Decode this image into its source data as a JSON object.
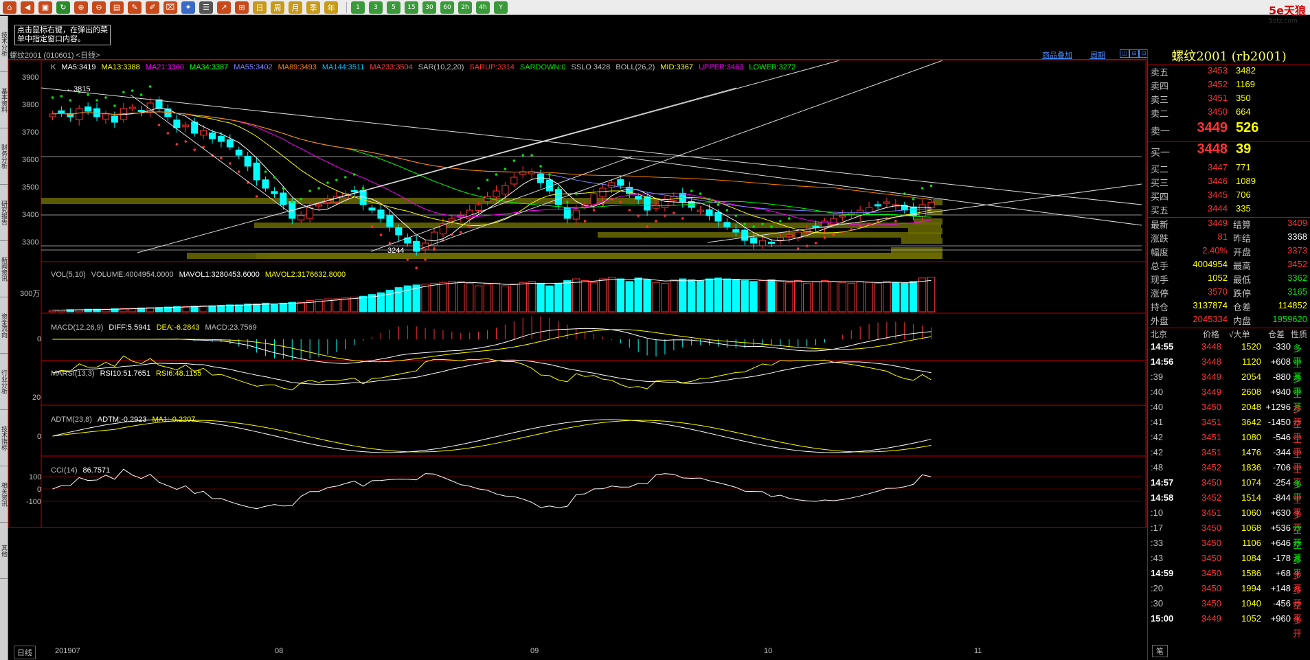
{
  "toolbar": {
    "buttons": [
      {
        "name": "home-icon",
        "glyph": "⌂",
        "color": "#c84a1a"
      },
      {
        "name": "back-icon",
        "glyph": "◀",
        "color": "#c84a1a"
      },
      {
        "name": "book-icon",
        "glyph": "▣",
        "color": "#c84a1a"
      },
      {
        "name": "refresh-icon",
        "glyph": "↻",
        "color": "#2a8a2a"
      },
      {
        "name": "zoom-in-icon",
        "glyph": "⊕",
        "color": "#c84a1a"
      },
      {
        "name": "zoom-out-icon",
        "glyph": "⊖",
        "color": "#c84a1a"
      },
      {
        "name": "bar-chart-icon",
        "glyph": "▤",
        "color": "#c84a1a"
      },
      {
        "name": "pen-icon",
        "glyph": "✎",
        "color": "#c84a1a"
      },
      {
        "name": "paint-icon",
        "glyph": "✐",
        "color": "#c84a1a"
      },
      {
        "name": "filter-icon",
        "glyph": "⌧",
        "color": "#c84a1a"
      },
      {
        "name": "new-icon",
        "glyph": "✦",
        "color": "#3a6ac8"
      },
      {
        "name": "list-icon",
        "glyph": "☰",
        "color": "#555555"
      },
      {
        "name": "trend-icon",
        "glyph": "↗",
        "color": "#c84a1a"
      },
      {
        "name": "tick-icon",
        "glyph": "⊞",
        "color": "#c84a1a"
      },
      {
        "name": "day-icon",
        "glyph": "日",
        "color": "#c89a1a"
      },
      {
        "name": "week-icon",
        "glyph": "周",
        "color": "#c89a1a"
      },
      {
        "name": "month-icon",
        "glyph": "月",
        "color": "#c89a1a"
      },
      {
        "name": "quarter-icon",
        "glyph": "季",
        "color": "#c89a1a"
      },
      {
        "name": "year-icon",
        "glyph": "年",
        "color": "#c89a1a"
      }
    ],
    "periods": [
      "1",
      "3",
      "5",
      "15",
      "30",
      "60",
      "2h",
      "4h",
      "Y"
    ],
    "brand": "5e天狼",
    "brand_url": "5etz.com"
  },
  "left_tabs": [
    "技术分析",
    "基本资料",
    "财务分析",
    "研究报告",
    "新闻资讯",
    "资金流向",
    "行业分析",
    "技术指标",
    "相关资讯",
    "其他"
  ],
  "hint": "点击鼠标右键，在弹出的菜单中指定窗口内容。",
  "chart_header": {
    "title": "螺纹2001 (010601) <日线>",
    "overlay_link": "商品叠加",
    "period_link": "周期",
    "buttons": [
      "◫",
      "⊟",
      "⊡"
    ]
  },
  "main_indicators": [
    {
      "text": "K",
      "color": "#c0c0c0"
    },
    {
      "text": "MA5:3419",
      "color": "#ffffff"
    },
    {
      "text": "MA13:3388",
      "color": "#ffff00"
    },
    {
      "text": "MA21:3360",
      "color": "#ff00ff"
    },
    {
      "text": "MA34:3387",
      "color": "#00ff00"
    },
    {
      "text": "MA55:3402",
      "color": "#8080ff"
    },
    {
      "text": "MA89:3493",
      "color": "#ff8000"
    },
    {
      "text": "MA144:3511",
      "color": "#00c0ff"
    },
    {
      "text": "MA233:3504",
      "color": "#ff4040"
    },
    {
      "text": "SAR(10,2,20)",
      "color": "#c0c0c0"
    },
    {
      "text": "SARUP:3314",
      "color": "#ff3232"
    },
    {
      "text": "SARDOWN:0",
      "color": "#00e600"
    },
    {
      "text": "SSLO 3428",
      "color": "#c0c0c0"
    },
    {
      "text": "BOLL(26,2)",
      "color": "#c0c0c0"
    },
    {
      "text": "MID:3367",
      "color": "#ffff00"
    },
    {
      "text": "UPPER:3463",
      "color": "#ff00ff"
    },
    {
      "text": "LOWER:3272",
      "color": "#00ff00"
    }
  ],
  "price_axis": [
    "3900",
    "3800",
    "3700",
    "3600",
    "3500",
    "3400",
    "3300"
  ],
  "annotations": {
    "high": "←3815",
    "low": "3244"
  },
  "vol_indicators": [
    {
      "text": "VOL(5,10)",
      "color": "#c0c0c0"
    },
    {
      "text": "VOLUME:4004954.0000",
      "color": "#c0c0c0"
    },
    {
      "text": "MAVOL1:3280453.6000",
      "color": "#ffffff"
    },
    {
      "text": "MAVOL2:3176632.8000",
      "color": "#ffff00"
    }
  ],
  "vol_axis": "300万",
  "macd_indicators": [
    {
      "text": "MACD(12,26,9)",
      "color": "#c0c0c0"
    },
    {
      "text": "DIFF:5.5941",
      "color": "#ffffff"
    },
    {
      "text": "DEA:-6.2843",
      "color": "#ffff00"
    },
    {
      "text": "MACD:23.7569",
      "color": "#c0c0c0"
    }
  ],
  "macd_axis": "0",
  "marsi_indicators": [
    {
      "text": "MARSI(13,3)",
      "color": "#c0c0c0"
    },
    {
      "text": "RSI10:51.7651",
      "color": "#ffffff"
    },
    {
      "text": "RSI6:48.1155",
      "color": "#ffff00"
    }
  ],
  "marsi_axis": "20",
  "adtm_indicators": [
    {
      "text": "ADTM(23,8)",
      "color": "#c0c0c0"
    },
    {
      "text": "ADTM:-0.2923",
      "color": "#ffffff"
    },
    {
      "text": "MA1:-0.2207",
      "color": "#ffff00"
    }
  ],
  "adtm_axis": "0",
  "cci_indicators": [
    {
      "text": "CCI(14)",
      "color": "#c0c0c0"
    },
    {
      "text": "86.7571",
      "color": "#ffffff"
    }
  ],
  "cci_axis": [
    "100",
    "0",
    "-100"
  ],
  "bottom": {
    "day_tab": "日线",
    "x_labels": [
      "201907",
      "08",
      "09",
      "10",
      "11"
    ],
    "pen_tab": "笔"
  },
  "quote": {
    "title": "螺纹2001 (rb2001)",
    "asks": [
      {
        "label": "卖五",
        "price": "3453",
        "vol": "3482"
      },
      {
        "label": "卖四",
        "price": "3452",
        "vol": "1169"
      },
      {
        "label": "卖三",
        "price": "3451",
        "vol": "350"
      },
      {
        "label": "卖二",
        "price": "3450",
        "vol": "664"
      }
    ],
    "ask1": {
      "label": "卖一",
      "price": "3449",
      "vol": "526"
    },
    "bid1": {
      "label": "买一",
      "price": "3448",
      "vol": "39"
    },
    "bids": [
      {
        "label": "买二",
        "price": "3447",
        "vol": "771"
      },
      {
        "label": "买三",
        "price": "3446",
        "vol": "1089"
      },
      {
        "label": "买四",
        "price": "3445",
        "vol": "706"
      },
      {
        "label": "买五",
        "price": "3444",
        "vol": "335"
      }
    ],
    "stats": [
      {
        "l1": "最新",
        "v1": "3449",
        "c1": "red",
        "l2": "结算",
        "v2": "3409",
        "c2": "red"
      },
      {
        "l1": "涨跌",
        "v1": "81",
        "c1": "red",
        "l2": "昨结",
        "v2": "3368",
        "c2": "wht"
      },
      {
        "l1": "幅度",
        "v1": "2.40%",
        "c1": "red",
        "l2": "开盘",
        "v2": "3373",
        "c2": "red"
      },
      {
        "l1": "总手",
        "v1": "4004954",
        "c1": "yel",
        "l2": "最高",
        "v2": "3452",
        "c2": "red"
      },
      {
        "l1": "现手",
        "v1": "1052",
        "c1": "yel",
        "l2": "最低",
        "v2": "3362",
        "c2": "grn"
      },
      {
        "l1": "涨停",
        "v1": "3570",
        "c1": "red",
        "l2": "跌停",
        "v2": "3165",
        "c2": "grn"
      },
      {
        "l1": "持仓",
        "v1": "3137874",
        "c1": "yel",
        "l2": "仓差",
        "v2": "114852",
        "c2": "yel"
      },
      {
        "l1": "外盘",
        "v1": "2045334",
        "c1": "red",
        "l2": "内盘",
        "v2": "1959620",
        "c2": "grn"
      }
    ],
    "tick_header": {
      "time": "北京",
      "price": "价格",
      "vol": "√大单",
      "diff": "仓差",
      "nature": "性质"
    },
    "ticks": [
      {
        "t": "14:55",
        "big": true,
        "p": "3448",
        "pc": "red",
        "v": "1520",
        "d": "-330",
        "dc": "wht",
        "n": "多平",
        "nc": "grn"
      },
      {
        "t": "14:56",
        "big": true,
        "p": "3448",
        "pc": "red",
        "v": "1120",
        "d": "+608",
        "dc": "wht",
        "n": "空开",
        "nc": "grn"
      },
      {
        "t": ":39",
        "big": false,
        "p": "3449",
        "pc": "red",
        "v": "2054",
        "d": "-880",
        "dc": "wht",
        "n": "多平",
        "nc": "grn"
      },
      {
        "t": ":40",
        "big": false,
        "p": "3449",
        "pc": "red",
        "v": "2608",
        "d": "+940",
        "dc": "wht",
        "n": "空开",
        "nc": "grn"
      },
      {
        "t": ":40",
        "big": false,
        "p": "3450",
        "pc": "red",
        "v": "2048",
        "d": "+1296",
        "dc": "wht",
        "n": "多开",
        "nc": "red"
      },
      {
        "t": ":41",
        "big": false,
        "p": "3451",
        "pc": "red",
        "v": "3642",
        "d": "-1450",
        "dc": "wht",
        "n": "空平",
        "nc": "red"
      },
      {
        "t": ":42",
        "big": false,
        "p": "3451",
        "pc": "red",
        "v": "1080",
        "d": "-546",
        "dc": "wht",
        "n": "空平",
        "nc": "red"
      },
      {
        "t": ":42",
        "big": false,
        "p": "3451",
        "pc": "red",
        "v": "1476",
        "d": "-344",
        "dc": "wht",
        "n": "空平",
        "nc": "red"
      },
      {
        "t": ":48",
        "big": false,
        "p": "3452",
        "pc": "red",
        "v": "1836",
        "d": "-706",
        "dc": "wht",
        "n": "空平",
        "nc": "red"
      },
      {
        "t": "14:57",
        "big": true,
        "p": "3450",
        "pc": "red",
        "v": "1074",
        "d": "-254",
        "dc": "wht",
        "n": "多平",
        "nc": "grn"
      },
      {
        "t": "14:58",
        "big": true,
        "p": "3452",
        "pc": "red",
        "v": "1514",
        "d": "-844",
        "dc": "wht",
        "n": "空平",
        "nc": "red"
      },
      {
        "t": ":10",
        "big": false,
        "p": "3451",
        "pc": "red",
        "v": "1060",
        "d": "+630",
        "dc": "wht",
        "n": "多开",
        "nc": "red"
      },
      {
        "t": ":17",
        "big": false,
        "p": "3450",
        "pc": "red",
        "v": "1068",
        "d": "+536",
        "dc": "wht",
        "n": "空开",
        "nc": "grn"
      },
      {
        "t": ":33",
        "big": false,
        "p": "3450",
        "pc": "red",
        "v": "1106",
        "d": "+646",
        "dc": "wht",
        "n": "空开",
        "nc": "grn"
      },
      {
        "t": ":43",
        "big": false,
        "p": "3450",
        "pc": "red",
        "v": "1084",
        "d": "-178",
        "dc": "wht",
        "n": "多平",
        "nc": "grn"
      },
      {
        "t": "14:59",
        "big": true,
        "p": "3450",
        "pc": "red",
        "v": "1586",
        "d": "+68",
        "dc": "wht",
        "n": "多开",
        "nc": "red"
      },
      {
        "t": ":20",
        "big": false,
        "p": "3450",
        "pc": "red",
        "v": "1994",
        "d": "+148",
        "dc": "wht",
        "n": "多开",
        "nc": "red"
      },
      {
        "t": ":30",
        "big": false,
        "p": "3450",
        "pc": "red",
        "v": "1040",
        "d": "-456",
        "dc": "wht",
        "n": "空平",
        "nc": "red"
      },
      {
        "t": "15:00",
        "big": true,
        "p": "3449",
        "pc": "red",
        "v": "1052",
        "d": "+960",
        "dc": "wht",
        "n": "多开",
        "nc": "red"
      }
    ]
  },
  "colors": {
    "up": "#ff3232",
    "down": "#00ffff",
    "panel_border": "#c00000",
    "volume_profile": "#6a6a00"
  },
  "chart_data": {
    "type": "candlestick",
    "ylim": [
      3240,
      3920
    ],
    "closes": [
      3770,
      3775,
      3760,
      3790,
      3780,
      3760,
      3770,
      3740,
      3790,
      3795,
      3780,
      3810,
      3790,
      3760,
      3720,
      3730,
      3700,
      3710,
      3680,
      3670,
      3650,
      3620,
      3580,
      3530,
      3500,
      3480,
      3440,
      3390,
      3400,
      3430,
      3440,
      3460,
      3470,
      3480,
      3490,
      3440,
      3420,
      3390,
      3360,
      3330,
      3300,
      3270,
      3300,
      3340,
      3370,
      3390,
      3400,
      3420,
      3440,
      3470,
      3490,
      3510,
      3540,
      3560,
      3560,
      3520,
      3490,
      3440,
      3390,
      3420,
      3440,
      3480,
      3500,
      3520,
      3510,
      3480,
      3460,
      3420,
      3440,
      3460,
      3470,
      3450,
      3430,
      3420,
      3400,
      3380,
      3360,
      3340,
      3310,
      3300,
      3310,
      3300,
      3320,
      3330,
      3340,
      3350,
      3360,
      3380,
      3390,
      3400,
      3410,
      3420,
      3430,
      3440,
      3450,
      3440,
      3420,
      3400,
      3440,
      3449
    ],
    "volumes": [
      0.2,
      0.2,
      0.25,
      0.25,
      0.3,
      0.3,
      0.3,
      0.35,
      0.4,
      0.4,
      0.45,
      0.5,
      0.5,
      0.55,
      0.6,
      0.6,
      0.65,
      0.7,
      0.7,
      0.75,
      0.8,
      0.8,
      0.9,
      0.9,
      1.0,
      0.9,
      1.0,
      1.1,
      1.1,
      1.3,
      1.4,
      1.5,
      1.5,
      1.6,
      1.7,
      1.8,
      2.0,
      2.2,
      2.5,
      2.8,
      3.0,
      3.1,
      3.2,
      3.3,
      3.4,
      3.5,
      3.5,
      3.3,
      3.0,
      3.2,
      3.3,
      3.0,
      3.2,
      3.4,
      3.5,
      3.3,
      3.0,
      3.3,
      3.6,
      3.8,
      3.6,
      3.4,
      3.8,
      4.0,
      3.8,
      3.5,
      3.9,
      3.7,
      3.4,
      3.3,
      3.7,
      3.8,
      3.7,
      3.6,
      3.8,
      3.9,
      3.8,
      3.7,
      3.6,
      3.5,
      3.6,
      3.7,
      3.5,
      3.4,
      3.6,
      3.3,
      3.5,
      3.6,
      3.5,
      3.4,
      3.3,
      3.5,
      3.4,
      3.3,
      3.5,
      3.4,
      3.3,
      3.5,
      3.9,
      4.0
    ]
  }
}
